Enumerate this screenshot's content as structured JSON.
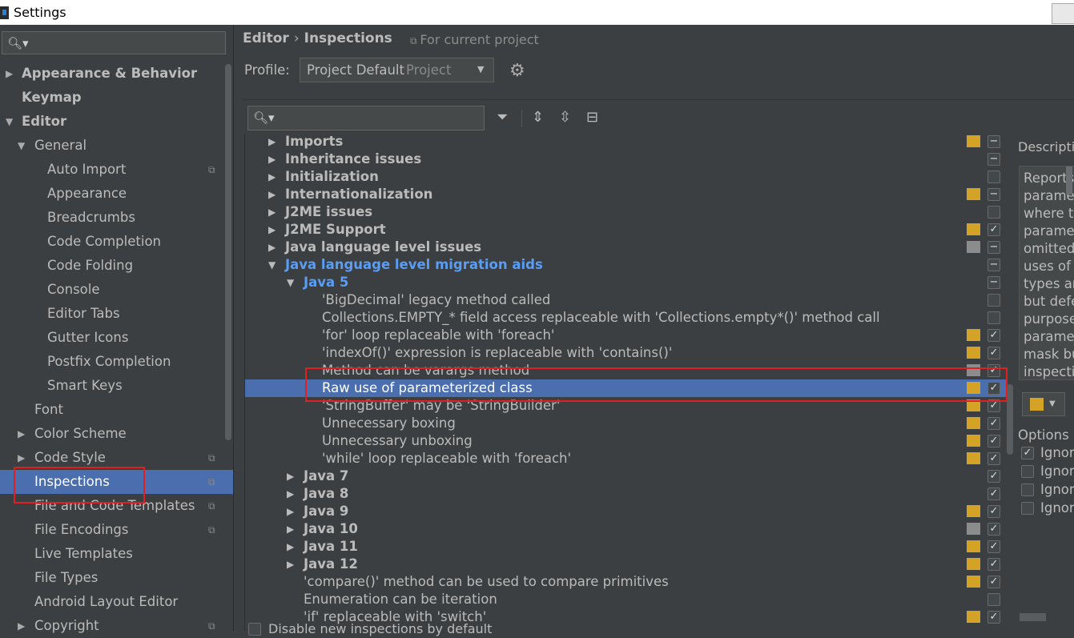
{
  "window": {
    "title": "Settings"
  },
  "colors": {
    "accent_selection": "#4b6eaf",
    "severity_warning": "#d4a325",
    "severity_weak": "#8c8c8c",
    "highlight_box": "#e02020"
  },
  "sidebar": {
    "search_placeholder": "",
    "items": [
      {
        "label": "Appearance & Behavior",
        "arrow": "▶",
        "bold": true,
        "level": 0
      },
      {
        "label": "Keymap",
        "arrow": "",
        "bold": true,
        "level": 0
      },
      {
        "label": "Editor",
        "arrow": "▼",
        "bold": true,
        "level": 0
      },
      {
        "label": "General",
        "arrow": "▼",
        "level": 1
      },
      {
        "label": "Auto Import",
        "arrow": "",
        "level": 2,
        "project": true
      },
      {
        "label": "Appearance",
        "arrow": "",
        "level": 2
      },
      {
        "label": "Breadcrumbs",
        "arrow": "",
        "level": 2
      },
      {
        "label": "Code Completion",
        "arrow": "",
        "level": 2
      },
      {
        "label": "Code Folding",
        "arrow": "",
        "level": 2
      },
      {
        "label": "Console",
        "arrow": "",
        "level": 2
      },
      {
        "label": "Editor Tabs",
        "arrow": "",
        "level": 2
      },
      {
        "label": "Gutter Icons",
        "arrow": "",
        "level": 2
      },
      {
        "label": "Postfix Completion",
        "arrow": "",
        "level": 2
      },
      {
        "label": "Smart Keys",
        "arrow": "",
        "level": 2
      },
      {
        "label": "Font",
        "arrow": "",
        "level": 1
      },
      {
        "label": "Color Scheme",
        "arrow": "▶",
        "level": 1
      },
      {
        "label": "Code Style",
        "arrow": "▶",
        "level": 1,
        "project": true
      },
      {
        "label": "Inspections",
        "arrow": "",
        "level": 1,
        "project": true,
        "selected": true
      },
      {
        "label": "File and Code Templates",
        "arrow": "",
        "level": 1,
        "project": true
      },
      {
        "label": "File Encodings",
        "arrow": "",
        "level": 1,
        "project": true
      },
      {
        "label": "Live Templates",
        "arrow": "",
        "level": 1
      },
      {
        "label": "File Types",
        "arrow": "",
        "level": 1
      },
      {
        "label": "Android Layout Editor",
        "arrow": "",
        "level": 1
      },
      {
        "label": "Copyright",
        "arrow": "▶",
        "level": 1,
        "project": true
      }
    ]
  },
  "header": {
    "breadcrumb_parent": "Editor",
    "breadcrumb_sep": "›",
    "breadcrumb_current": "Inspections",
    "scope_note": "For current project",
    "profile_label": "Profile:",
    "profile_value": "Project Default",
    "profile_scope": "Project"
  },
  "tree": {
    "search_placeholder": "",
    "rows": [
      {
        "label": "Imports",
        "level": 0,
        "arrow": "▶",
        "bold": true,
        "severity": "warning",
        "check": "mixed"
      },
      {
        "label": "Inheritance issues",
        "level": 0,
        "arrow": "▶",
        "bold": true,
        "severity": "",
        "check": "mixed"
      },
      {
        "label": "Initialization",
        "level": 0,
        "arrow": "▶",
        "bold": true,
        "severity": "",
        "check": "off"
      },
      {
        "label": "Internationalization",
        "level": 0,
        "arrow": "▶",
        "bold": true,
        "severity": "warning",
        "check": "mixed"
      },
      {
        "label": "J2ME issues",
        "level": 0,
        "arrow": "▶",
        "bold": true,
        "severity": "",
        "check": "off"
      },
      {
        "label": "J2ME Support",
        "level": 0,
        "arrow": "▶",
        "bold": true,
        "severity": "warning",
        "check": "on"
      },
      {
        "label": "Java language level issues",
        "level": 0,
        "arrow": "▶",
        "bold": true,
        "severity": "weak",
        "check": "mixed"
      },
      {
        "label": "Java language level migration aids",
        "level": 0,
        "arrow": "▼",
        "bold": true,
        "blue": true,
        "severity": "",
        "check": "mixed"
      },
      {
        "label": "Java 5",
        "level": 1,
        "arrow": "▼",
        "bold": true,
        "blue": true,
        "severity": "",
        "check": "mixed"
      },
      {
        "label": "'BigDecimal' legacy method called",
        "level": 2,
        "arrow": "",
        "severity": "",
        "check": "off"
      },
      {
        "label": "Collections.EMPTY_* field access replaceable with 'Collections.empty*()' method call",
        "level": 2,
        "arrow": "",
        "severity": "",
        "check": "off"
      },
      {
        "label": "'for' loop replaceable with 'foreach'",
        "level": 2,
        "arrow": "",
        "severity": "warning",
        "check": "on"
      },
      {
        "label": "'indexOf()' expression is replaceable with 'contains()'",
        "level": 2,
        "arrow": "",
        "severity": "warning",
        "check": "on"
      },
      {
        "label": "Method can be varargs method",
        "level": 2,
        "arrow": "",
        "severity": "weak",
        "check": "on"
      },
      {
        "label": "Raw use of parameterized class",
        "level": 2,
        "arrow": "",
        "severity": "warning",
        "check": "on",
        "selected": true
      },
      {
        "label": "'StringBuffer' may be 'StringBuilder'",
        "level": 2,
        "arrow": "",
        "severity": "warning",
        "check": "on"
      },
      {
        "label": "Unnecessary boxing",
        "level": 2,
        "arrow": "",
        "severity": "warning",
        "check": "on"
      },
      {
        "label": "Unnecessary unboxing",
        "level": 2,
        "arrow": "",
        "severity": "warning",
        "check": "on"
      },
      {
        "label": "'while' loop replaceable with 'foreach'",
        "level": 2,
        "arrow": "",
        "severity": "warning",
        "check": "on"
      },
      {
        "label": "Java 7",
        "level": 1,
        "arrow": "▶",
        "bold": true,
        "severity": "",
        "check": "on"
      },
      {
        "label": "Java 8",
        "level": 1,
        "arrow": "▶",
        "bold": true,
        "severity": "",
        "check": "on"
      },
      {
        "label": "Java 9",
        "level": 1,
        "arrow": "▶",
        "bold": true,
        "severity": "warning",
        "check": "on"
      },
      {
        "label": "Java 10",
        "level": 1,
        "arrow": "▶",
        "bold": true,
        "severity": "weak",
        "check": "on"
      },
      {
        "label": "Java 11",
        "level": 1,
        "arrow": "▶",
        "bold": true,
        "severity": "warning",
        "check": "on"
      },
      {
        "label": "Java 12",
        "level": 1,
        "arrow": "▶",
        "bold": true,
        "severity": "warning",
        "check": "on"
      },
      {
        "label": "'compare()' method can be used to compare primitives",
        "level": 1,
        "arrow": "",
        "severity": "warning",
        "check": "on"
      },
      {
        "label": "Enumeration can be iteration",
        "level": 1,
        "arrow": "",
        "severity": "",
        "check": "off"
      },
      {
        "label": "'if' replaceable with 'switch'",
        "level": 1,
        "arrow": "",
        "severity": "warning",
        "check": "on"
      }
    ],
    "bottom_checkbox_label": "Disable new inspections by default"
  },
  "description": {
    "label": "Descriptio",
    "lines": [
      "Reports",
      "paramet",
      "where th",
      "paramet",
      "omitted.",
      "uses of p",
      "types ar",
      "but defe",
      "purpose",
      "paramet",
      "mask bu",
      "inspectio"
    ]
  },
  "options": {
    "label": "Options",
    "items": [
      {
        "label": "Ignor",
        "checked": true
      },
      {
        "label": "Ignor",
        "checked": false
      },
      {
        "label": "Ignor",
        "checked": false
      },
      {
        "label": "Ignor",
        "checked": false
      }
    ]
  }
}
